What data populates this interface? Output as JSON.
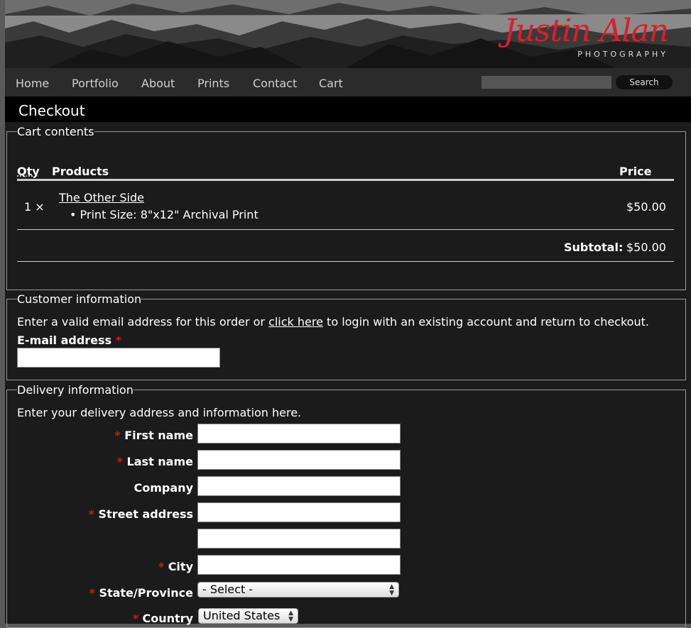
{
  "brand": {
    "name": "Justin Alan",
    "tagline": "PHOTOGRAPHY"
  },
  "nav": {
    "items": [
      "Home",
      "Portfolio",
      "About",
      "Prints",
      "Contact",
      "Cart"
    ],
    "search_placeholder": "",
    "search_button": "Search"
  },
  "page_title": "Checkout",
  "cart": {
    "legend": "Cart contents",
    "col_qty": "Qty",
    "col_products": "Products",
    "col_price": "Price",
    "item": {
      "qty": "1 ×",
      "title": "The Other Side",
      "option": "Print Size: 8\"x12\" Archival Print",
      "price": "$50.00"
    },
    "subtotal_label": "Subtotal:",
    "subtotal_value": "$50.00"
  },
  "customer": {
    "legend": "Customer information",
    "intro_before": "Enter a valid email address for this order or ",
    "intro_link": "click here",
    "intro_after": " to login with an existing account and return to checkout.",
    "email_label": "E-mail address",
    "required_mark": "*"
  },
  "delivery": {
    "legend": "Delivery information",
    "intro": "Enter your delivery address and information here.",
    "first_name": "First name",
    "last_name": "Last name",
    "company": "Company",
    "street": "Street address",
    "city": "City",
    "state": "State/Province",
    "state_value": "- Select -",
    "country": "Country",
    "country_value": "United States",
    "required_mark": "*"
  }
}
